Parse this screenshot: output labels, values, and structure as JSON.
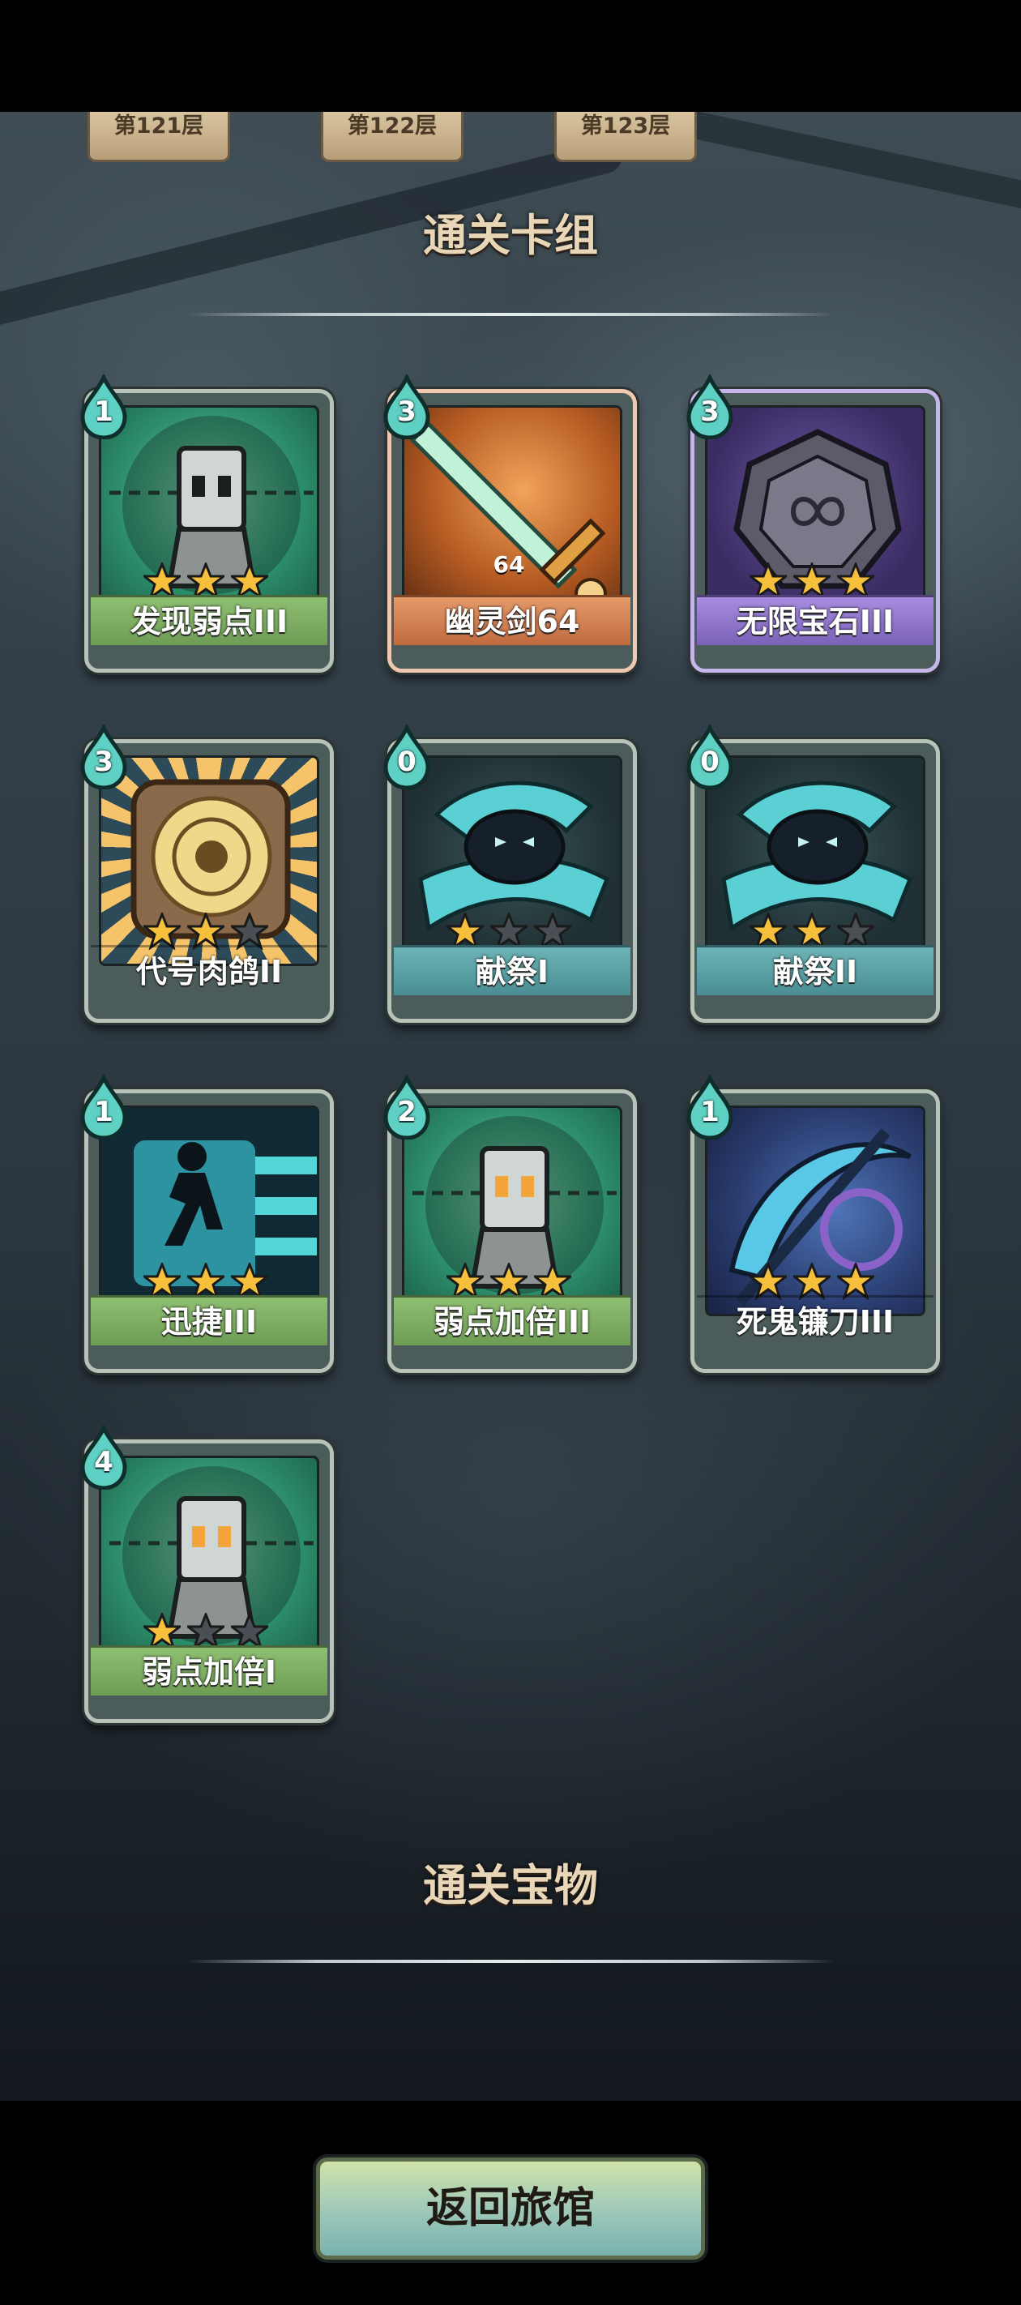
{
  "floor_tabs": [
    {
      "label": "第121层"
    },
    {
      "label": "第122层"
    },
    {
      "label": "第123层"
    }
  ],
  "sections": {
    "deck_title": "通关卡组",
    "treasure_title": "通关宝物"
  },
  "cards": [
    {
      "name": "发现弱点III",
      "cost": "1",
      "stars": 3,
      "style": "green",
      "icon": "weakness-target-icon"
    },
    {
      "name": "幽灵剑64",
      "cost": "3",
      "stars": 0,
      "style": "orange",
      "icon": "ghost-sword-icon",
      "level": "64"
    },
    {
      "name": "无限宝石III",
      "cost": "3",
      "stars": 3,
      "style": "purple",
      "icon": "infinity-gem-icon"
    },
    {
      "name": "代号肉鸽II",
      "cost": "3",
      "stars": 2,
      "style": "gold",
      "icon": "rogue-disc-icon"
    },
    {
      "name": "献祭I",
      "cost": "0",
      "stars": 1,
      "style": "teal",
      "icon": "sacrifice-ghost-icon"
    },
    {
      "name": "献祭II",
      "cost": "0",
      "stars": 2,
      "style": "teal",
      "icon": "sacrifice-ghost-icon"
    },
    {
      "name": "迅捷III",
      "cost": "1",
      "stars": 3,
      "style": "green",
      "icon": "dash-runner-icon"
    },
    {
      "name": "弱点加倍III",
      "cost": "2",
      "stars": 3,
      "style": "green",
      "icon": "weakness-double-icon"
    },
    {
      "name": "死鬼镰刀III",
      "cost": "1",
      "stars": 3,
      "style": "blue",
      "icon": "death-scythe-icon"
    },
    {
      "name": "弱点加倍I",
      "cost": "4",
      "stars": 1,
      "style": "green",
      "icon": "weakness-double-icon"
    }
  ],
  "back_button": {
    "label": "返回旅馆"
  },
  "colors": {
    "title_text": "#e8d6b6",
    "star_filled": "#f6c03c",
    "star_empty": "#4a4f55",
    "cost_drop": "#5fd1c4"
  }
}
